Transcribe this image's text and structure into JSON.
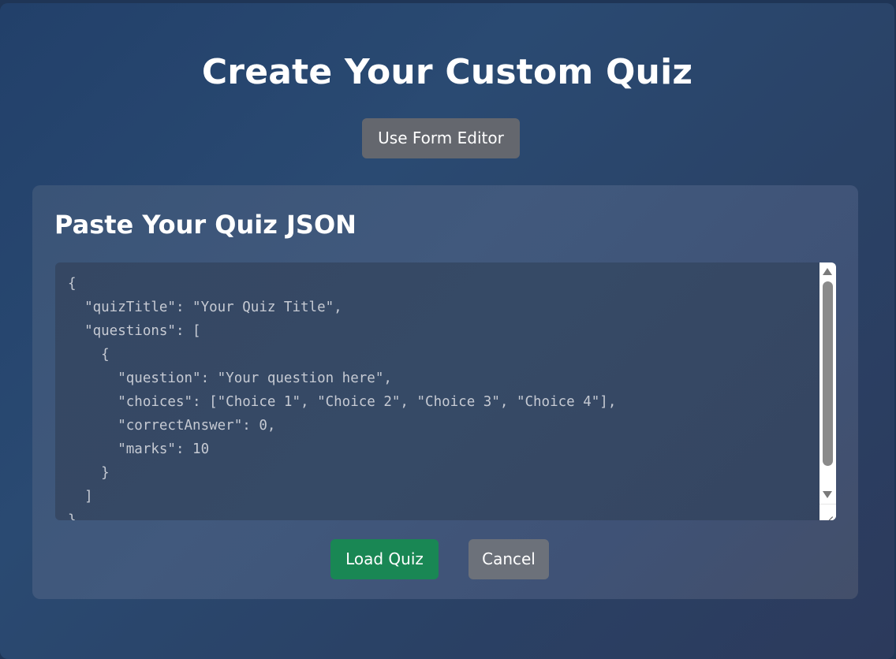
{
  "page": {
    "title": "Create Your Custom Quiz",
    "form_editor_label": "Use Form Editor"
  },
  "json_panel": {
    "title": "Paste Your Quiz JSON",
    "content": "{\n  \"quizTitle\": \"Your Quiz Title\",\n  \"questions\": [\n    {\n      \"question\": \"Your question here\",\n      \"choices\": [\"Choice 1\", \"Choice 2\", \"Choice 3\", \"Choice 4\"],\n      \"correctAnswer\": 0,\n      \"marks\": 10\n    }\n  ]\n}",
    "load_label": "Load Quiz",
    "cancel_label": "Cancel"
  },
  "colors": {
    "load_button": "#198754",
    "secondary_button": "#6c717a"
  },
  "icons": {
    "scroll_up": "triangle-up-icon",
    "scroll_down": "triangle-down-icon",
    "resize": "resize-grip-icon"
  }
}
